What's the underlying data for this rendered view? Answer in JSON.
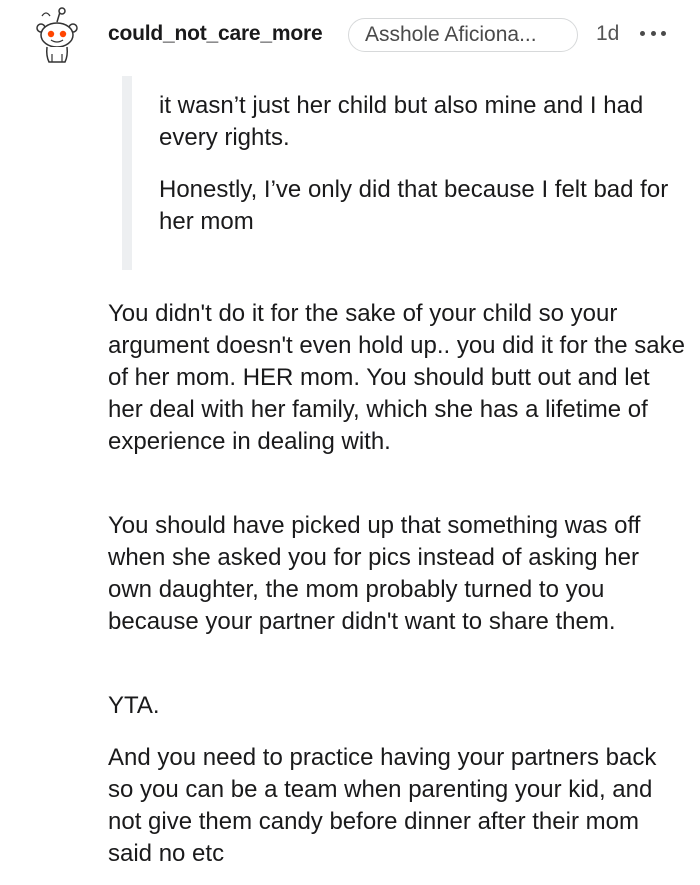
{
  "comment": {
    "author": "could_not_care_more",
    "flair": "Asshole Aficiona...",
    "time": "1d",
    "more_icon": "more-horizontal-icon",
    "avatar_icon": "snoo-avatar-icon",
    "quote": {
      "paragraphs": [
        "it wasn’t just her child but also mine and I had every rights.",
        "Honestly, I’ve only did that because I felt bad for her mom"
      ]
    },
    "body": [
      "You didn't do it for the sake of your child so your argument doesn't even hold up.. you did it for the sake of her mom. HER mom. You should butt out and let her deal with her family, which she has a lifetime of experience in dealing with.",
      "You should have picked up that something was off when she asked you for pics instead of asking her own daughter, the mom probably turned to you because your partner didn't want to share them.",
      "YTA.",
      "And you need to practice having your partners back so you can be a team when parenting your kid, and not give them candy before dinner after their mom said no etc"
    ]
  },
  "colors": {
    "text": "#1a1a1b",
    "quote_bar": "#edeff1",
    "flair_border": "#d7d9da",
    "avatar_eye": "#ff4500"
  }
}
